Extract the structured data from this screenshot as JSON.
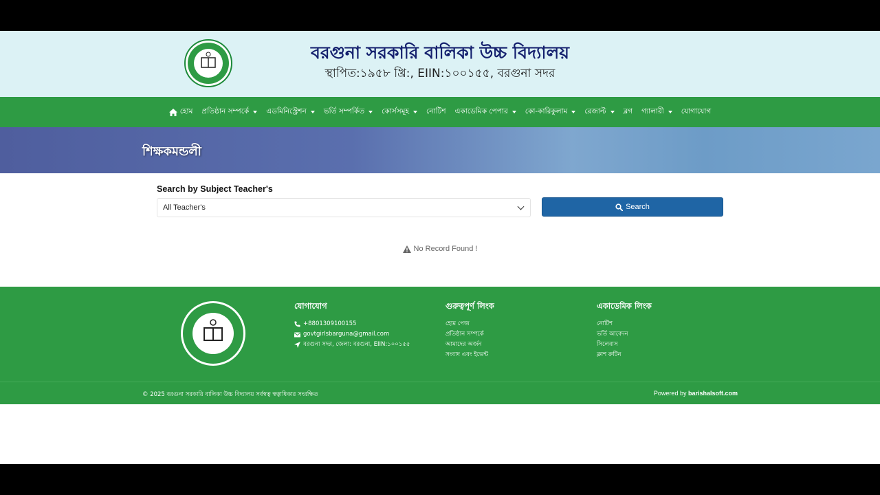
{
  "header": {
    "title": "বরগুনা সরকারি বালিকা উচ্চ বিদ্যালয়",
    "subtitle": "স্থাপিত:১৯৫৮ খ্রি:, EIIN:১০০১৫৫, বরগুনা সদর"
  },
  "nav": {
    "items": [
      {
        "label": "হোম",
        "icon": "home-icon",
        "dropdown": false
      },
      {
        "label": "প্রতিষ্ঠান সম্পর্কে",
        "dropdown": true
      },
      {
        "label": "এডমিনিস্ট্রেশন",
        "dropdown": true
      },
      {
        "label": "ভর্তি সম্পর্কিত",
        "dropdown": true
      },
      {
        "label": "কোর্সসমূহ",
        "dropdown": true
      },
      {
        "label": "নোটিশ",
        "dropdown": false
      },
      {
        "label": "একাডেমিক পেপার",
        "dropdown": true
      },
      {
        "label": "কো-কারিকুলাম",
        "dropdown": true
      },
      {
        "label": "রেজাল্ট",
        "dropdown": true
      },
      {
        "label": "ব্লগ",
        "dropdown": false
      },
      {
        "label": "গ্যালারী",
        "dropdown": true
      },
      {
        "label": "যোগাযোগ",
        "dropdown": false
      }
    ]
  },
  "banner": {
    "title": "শিক্ষকমন্ডলী"
  },
  "search": {
    "label": "Search by Subject Teacher's",
    "select_value": "All Teacher's",
    "button_label": "Search",
    "no_record": "No Record Found !"
  },
  "footer": {
    "contact": {
      "heading": "যোগাযোগ",
      "phone": "+8801309100155",
      "email": "govtgirlsbarguna@gmail.com",
      "address": "বরগুনা সদর, জেলা: বরগুনা, EIIN:১০০১৫৫"
    },
    "important_links": {
      "heading": "গুরুত্বপূর্ণ লিংক",
      "links": [
        "হোম পেজ",
        "প্রতিষ্ঠান সম্পর্কে",
        "আমাদের অর্জন",
        "সংবাদ এবং ইভেন্ট"
      ]
    },
    "academic_links": {
      "heading": "একাডেমিক লিংক",
      "links": [
        "নোটিশ",
        "ভর্তি আবেদন",
        "সিলেবাস",
        "ক্লাশ রুটিন"
      ]
    }
  },
  "copyright": {
    "text": "© 2025 বরগুনা সরকারি বালিকা উচ্চ বিদ্যালয় সর্বস্বত্ব স্বত্বাধিকার সংরক্ষিত",
    "powered_prefix": "Powered by",
    "powered_link": "barishalsoft.com"
  },
  "colors": {
    "header_bg": "#dcf2f5",
    "nav_green": "#2e9b44",
    "title_navy": "#14206e",
    "button_blue": "#1f65a5"
  }
}
